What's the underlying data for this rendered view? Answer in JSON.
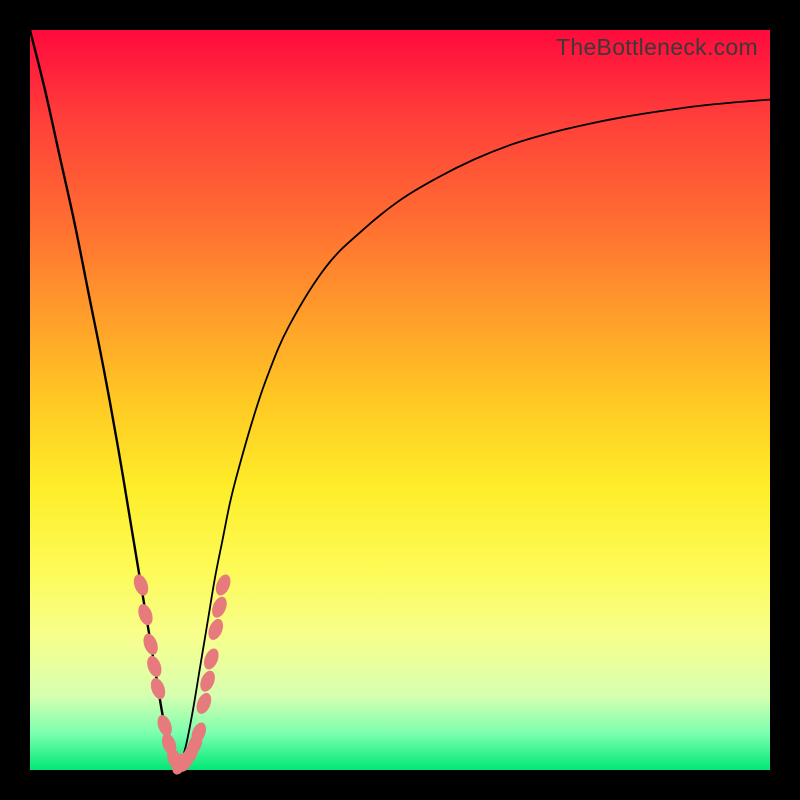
{
  "watermark": "TheBottleneck.com",
  "colors": {
    "frame": "#000000",
    "curve": "#000000",
    "marker": "#e77a7d"
  },
  "chart_data": {
    "type": "line",
    "title": "",
    "xlabel": "",
    "ylabel": "",
    "xlim": [
      0,
      100
    ],
    "ylim": [
      0,
      100
    ],
    "grid": false,
    "legend": false,
    "x": [
      0,
      2,
      4,
      6,
      8,
      10,
      12,
      14,
      15,
      16,
      17,
      18,
      19,
      20,
      21,
      22,
      23,
      24,
      25,
      26,
      27,
      28,
      30,
      32,
      35,
      40,
      45,
      50,
      55,
      60,
      65,
      70,
      75,
      80,
      85,
      90,
      95,
      100
    ],
    "series": [
      {
        "name": "bottleneck-curve",
        "values": [
          100,
          92,
          83,
          74,
          64,
          54,
          43,
          31,
          25,
          19,
          13,
          7,
          3,
          0,
          3,
          8,
          14,
          20,
          26,
          31,
          36,
          40,
          47,
          53,
          60,
          68,
          73,
          77,
          80,
          82.5,
          84.5,
          86,
          87.2,
          88.2,
          89,
          89.7,
          90.2,
          90.6
        ]
      }
    ],
    "markers": {
      "name": "data-points",
      "points": [
        {
          "x": 15.0,
          "y": 25
        },
        {
          "x": 15.6,
          "y": 21
        },
        {
          "x": 16.3,
          "y": 17
        },
        {
          "x": 16.8,
          "y": 14
        },
        {
          "x": 17.3,
          "y": 11
        },
        {
          "x": 18.2,
          "y": 6
        },
        {
          "x": 18.8,
          "y": 3.5
        },
        {
          "x": 19.5,
          "y": 1.5
        },
        {
          "x": 20.2,
          "y": 0.8
        },
        {
          "x": 21.0,
          "y": 1.2
        },
        {
          "x": 21.7,
          "y": 2.2
        },
        {
          "x": 22.3,
          "y": 3.5
        },
        {
          "x": 22.8,
          "y": 5
        },
        {
          "x": 23.5,
          "y": 9
        },
        {
          "x": 24.0,
          "y": 12
        },
        {
          "x": 24.5,
          "y": 15
        },
        {
          "x": 25.1,
          "y": 19
        },
        {
          "x": 25.6,
          "y": 22
        },
        {
          "x": 26.1,
          "y": 25
        }
      ]
    }
  }
}
